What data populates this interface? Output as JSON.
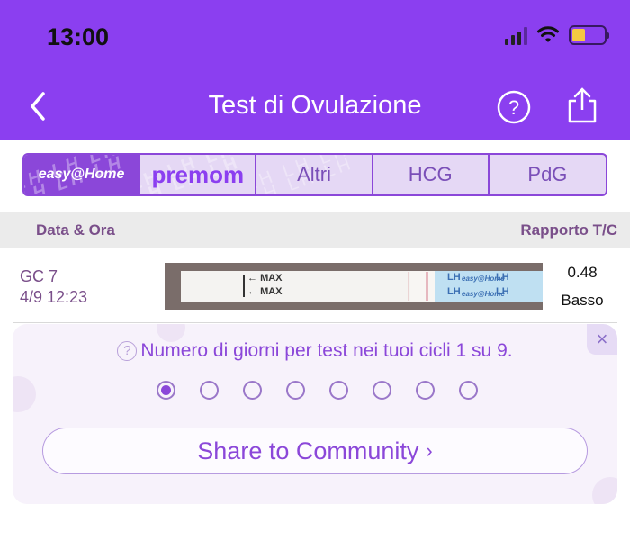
{
  "status_bar": {
    "time": "13:00"
  },
  "header": {
    "title": "Test di Ovulazione"
  },
  "brand_tabs": {
    "easy": "easy@Home",
    "premom": "premom",
    "altri": "Altri",
    "hcg": "HCG",
    "pdg": "PdG"
  },
  "table": {
    "col_left": "Data & Ora",
    "col_right": "Rapporto T/C",
    "rows": [
      {
        "cycle": "GC 7",
        "date": "4/9 12:23",
        "ratio": "0.48",
        "level": "Basso",
        "strip_max": "MAX",
        "strip_lh": "LH",
        "strip_brand": "easy@Home"
      }
    ]
  },
  "card": {
    "question_mark": "?",
    "message": "Numero di giorni per test nei tuoi cicli 1 su 9.",
    "close": "×",
    "total_days": 8,
    "active_index": 0,
    "community_button": "Share to Community",
    "chevron": "›"
  },
  "colors": {
    "brand": "#8b3ff0",
    "accent": "#8b47d9"
  }
}
